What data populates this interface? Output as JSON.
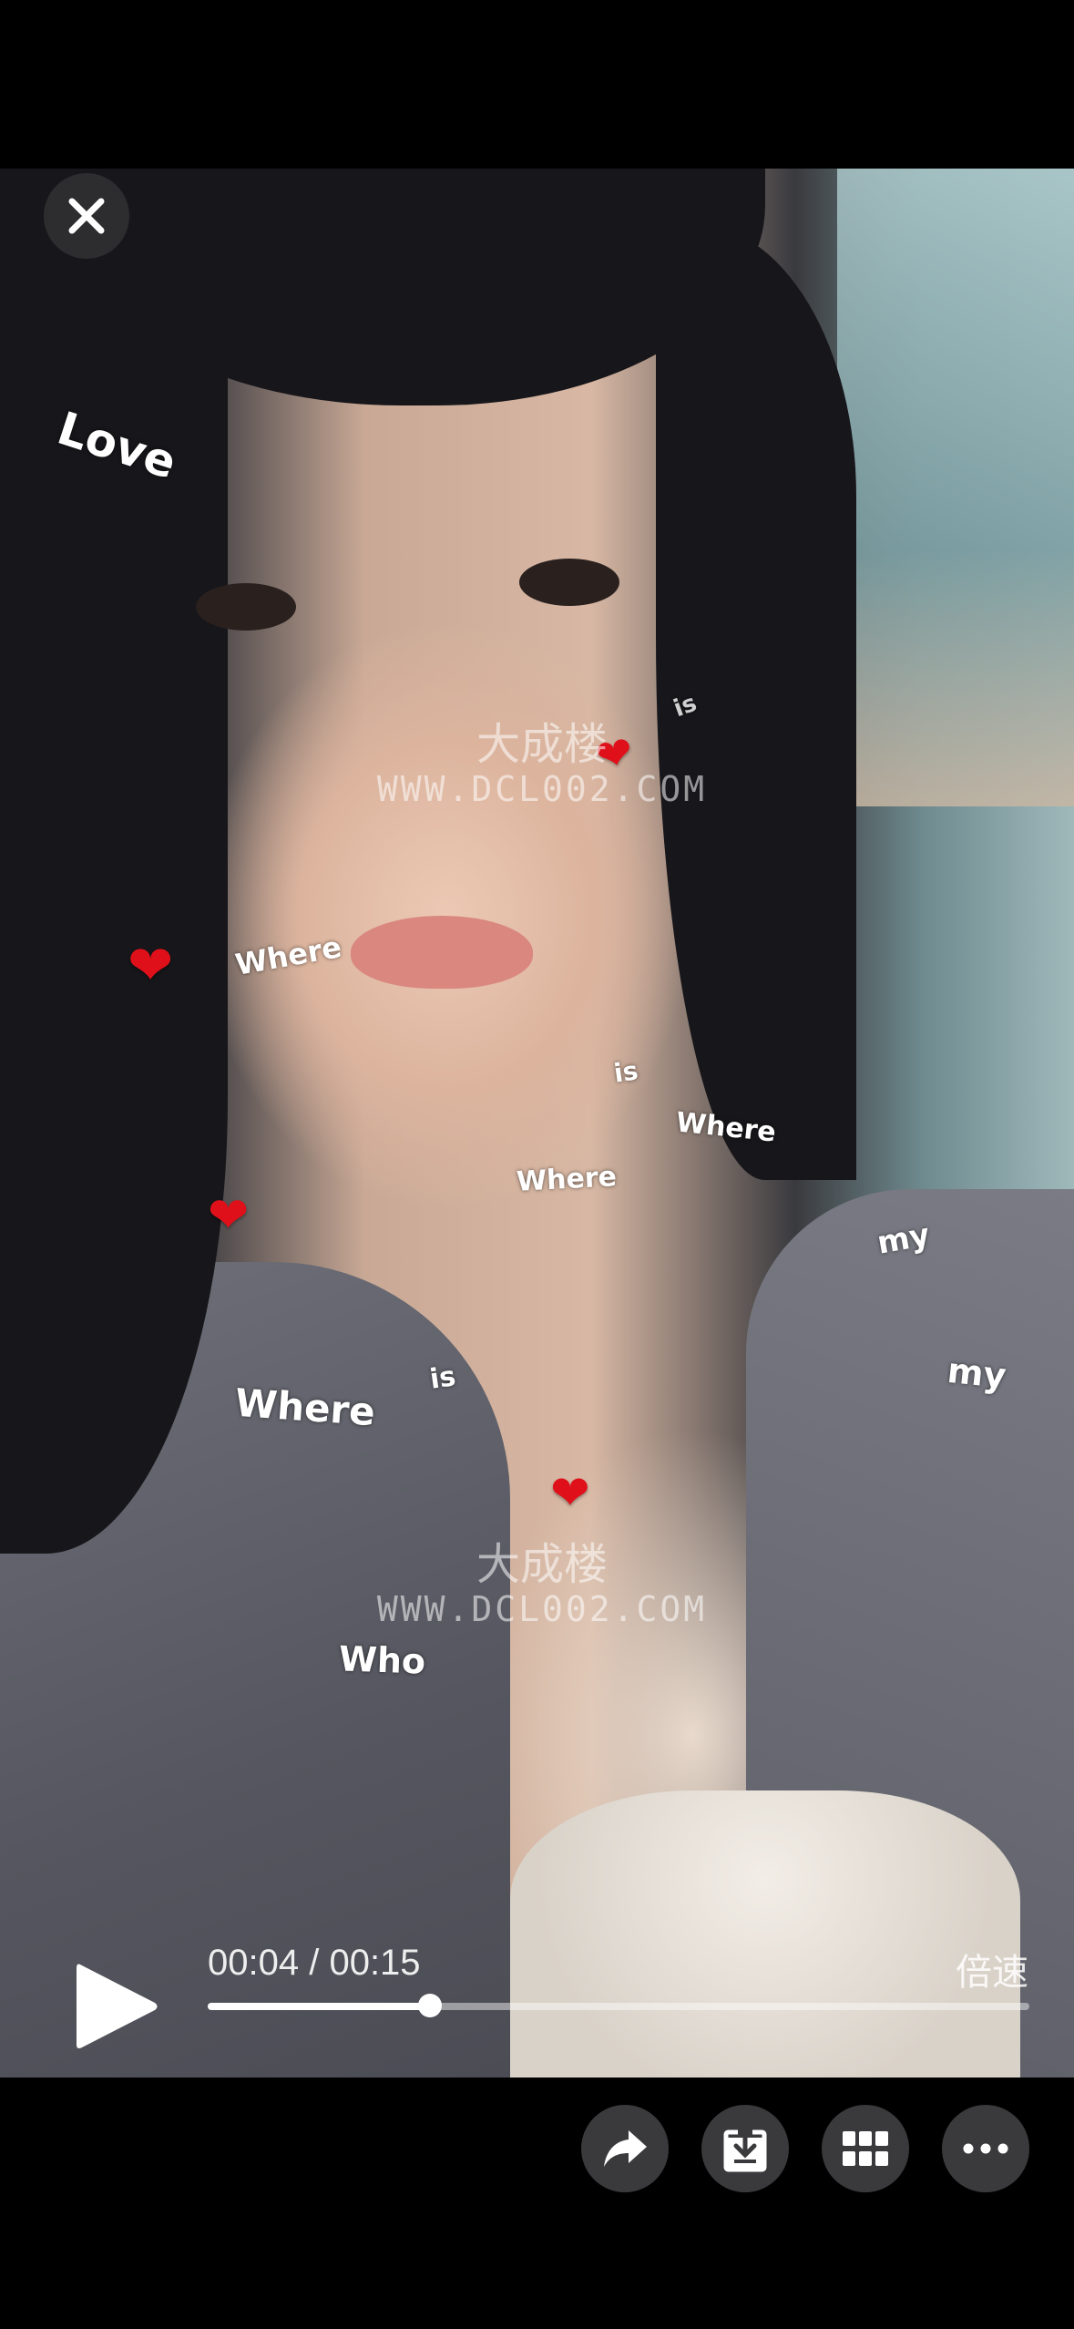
{
  "player": {
    "current_time": "00:04",
    "separator": " / ",
    "duration": "00:15",
    "speed_label": "倍速",
    "progress": 0.27
  },
  "overlay_words": {
    "love": "Love",
    "where1": "Where",
    "where2": "Where",
    "where3": "Where",
    "where4": "Where",
    "is1": "is",
    "is2": "is",
    "is3": "is",
    "my1": "my",
    "my2": "my",
    "who": "Who"
  },
  "watermark": {
    "line1": "大成楼",
    "line2": "WWW.DCL002.COM"
  },
  "icons": {
    "close": "close-icon",
    "play": "play-icon",
    "share": "share-icon",
    "download": "download-icon",
    "grid": "grid-icon",
    "more": "more-icon"
  },
  "colors": {
    "background": "#000000",
    "button_bg": "#3a3a3c",
    "heart": "#e0101a"
  }
}
